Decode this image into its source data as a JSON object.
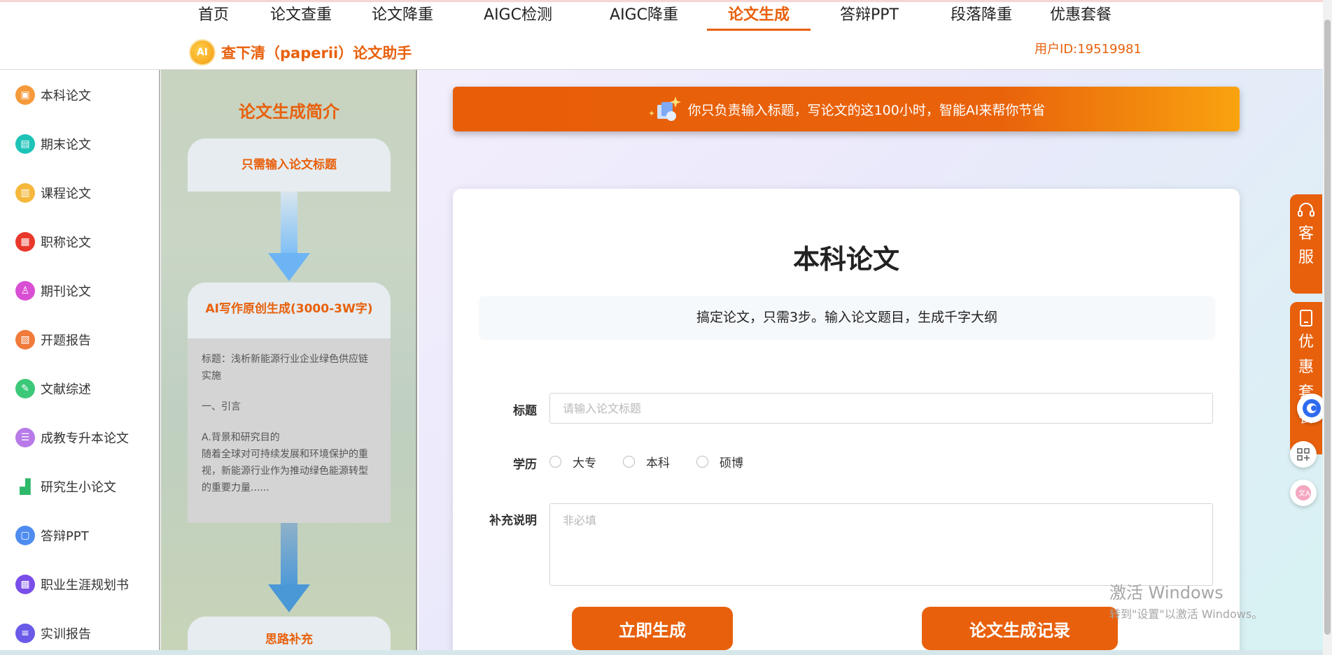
{
  "nav": {
    "items": [
      "首页",
      "论文查重",
      "论文降重",
      "AIGC检测",
      "AIGC降重",
      "论文生成",
      "答辩PPT",
      "段落降重",
      "优惠套餐"
    ],
    "active_index": 5
  },
  "brand": {
    "logo_text": "AI",
    "name": "查下清（paperii）论文助手"
  },
  "user": {
    "id_label": "用户ID:19519981"
  },
  "sidebar": {
    "items": [
      {
        "label": "本科论文",
        "icon": "document-icon",
        "color": "#f59a3c"
      },
      {
        "label": "期末论文",
        "icon": "file-icon",
        "color": "#1ec3b8"
      },
      {
        "label": "课程论文",
        "icon": "book-icon",
        "color": "#f5b83c"
      },
      {
        "label": "职称论文",
        "icon": "certificate-icon",
        "color": "#e8382b"
      },
      {
        "label": "期刊论文",
        "icon": "journal-icon",
        "color": "#d94fd4"
      },
      {
        "label": "开题报告",
        "icon": "report-icon",
        "color": "#f07a3a"
      },
      {
        "label": "文献综述",
        "icon": "pen-icon",
        "color": "#3cc879"
      },
      {
        "label": "成教专升本论文",
        "icon": "stack-icon",
        "color": "#b87ae8"
      },
      {
        "label": "研究生小论文",
        "icon": "chart-icon",
        "color": "#2fb86a"
      },
      {
        "label": "答辩PPT",
        "icon": "slides-icon",
        "color": "#4e8cf0"
      },
      {
        "label": "职业生涯规划书",
        "icon": "plan-icon",
        "color": "#7a4ee8"
      },
      {
        "label": "实训报告",
        "icon": "list-icon",
        "color": "#6a5ae8"
      }
    ]
  },
  "intro": {
    "title": "论文生成简介",
    "step1": "只需输入论文标题",
    "step2": "AI写作原创生成(3000-3W字)",
    "sample": {
      "line1": "标题：浅析新能源行业企业绿色供应链实施",
      "line2": "一、引言",
      "line3": "A.背景和研究目的",
      "line4": "随着全球对可持续发展和环境保护的重视，新能源行业作为推动绿色能源转型的重要力量......"
    },
    "step3": "思路补充"
  },
  "banner": {
    "text": "你只负责输入标题，写论文的这100小时，智能AI来帮你节省"
  },
  "form": {
    "title": "本科论文",
    "tagline": "搞定论文，只需3步。输入论文题目，生成千字大纲",
    "title_label": "标题",
    "title_placeholder": "请输入论文标题",
    "title_value": "",
    "degree_label": "学历",
    "degree_options": [
      "大专",
      "本科",
      "硕博"
    ],
    "note_label": "补充说明",
    "note_placeholder": "非必填",
    "generate_button": "立即生成",
    "history_button": "论文生成记录"
  },
  "float": {
    "service_label": "客服",
    "package_label": "优惠套餐"
  },
  "watermark": {
    "line1": "激活 Windows",
    "line2": "转到\"设置\"以激活 Windows。"
  },
  "colors": {
    "accent": "#e8600c"
  }
}
